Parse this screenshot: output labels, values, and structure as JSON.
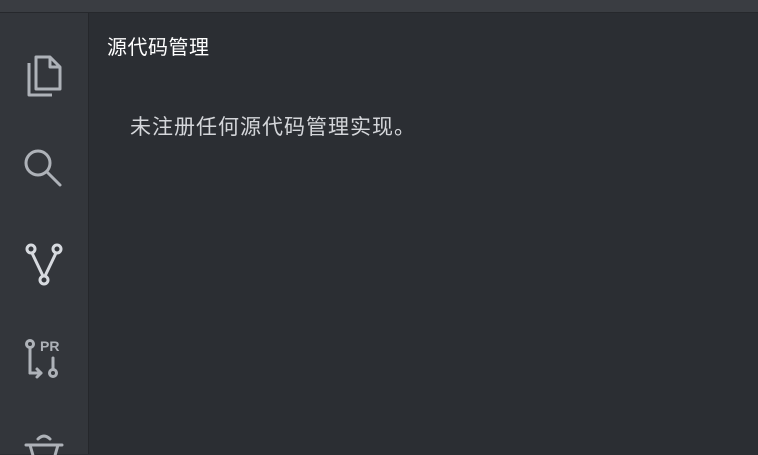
{
  "activity_bar": {
    "items": [
      {
        "id": "explorer",
        "icon": "files-icon"
      },
      {
        "id": "search",
        "icon": "search-icon"
      },
      {
        "id": "source-control",
        "icon": "source-control-icon",
        "active": true
      },
      {
        "id": "pull-requests",
        "icon": "pull-request-icon",
        "badge": "PR"
      },
      {
        "id": "extensions",
        "icon": "extensions-icon"
      }
    ]
  },
  "panel": {
    "title": "源代码管理",
    "empty_message": "未注册任何源代码管理实现。"
  },
  "colors": {
    "background": "#2b2e33",
    "activity_bar": "#33363b",
    "icon": "#aeb2b8",
    "title_text": "#ffffff",
    "body_text": "#d4d6da"
  }
}
